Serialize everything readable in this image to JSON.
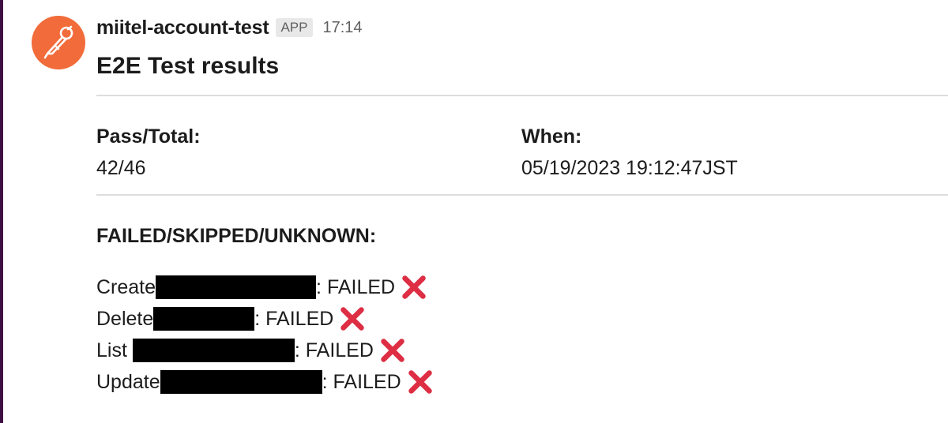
{
  "message": {
    "sender": "miitel-account-test",
    "badge": "APP",
    "time": "17:14",
    "title": "E2E Test results"
  },
  "summary": {
    "pass_total_label": "Pass/Total:",
    "pass_total_value": "42/46",
    "when_label": "When:",
    "when_value": "05/19/2023 19:12:47JST"
  },
  "failures": {
    "title": "FAILED/SKIPPED/UNKNOWN:",
    "items": [
      {
        "prefix": "Create",
        "status": ": FAILED",
        "icon": "cross-mark-icon"
      },
      {
        "prefix": "Delete",
        "status": ": FAILED",
        "icon": "cross-mark-icon"
      },
      {
        "prefix": "List ",
        "status": ": FAILED",
        "icon": "cross-mark-icon"
      },
      {
        "prefix": "Update",
        "status": ": FAILED",
        "icon": "cross-mark-icon"
      }
    ]
  },
  "colors": {
    "avatar_bg": "#f26b3a",
    "failed_icon": "#dd2e44",
    "redaction": "#000000"
  }
}
